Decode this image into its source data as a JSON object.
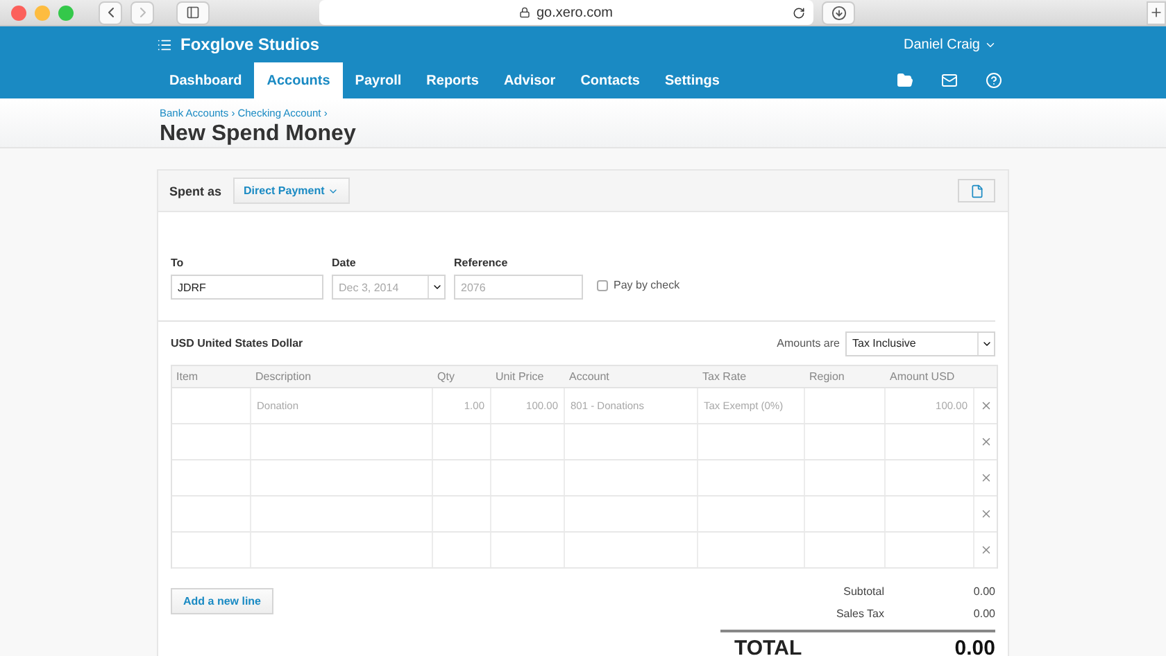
{
  "browser": {
    "url": "go.xero.com"
  },
  "header": {
    "organisation": "Foxglove Studios",
    "user": "Daniel Craig",
    "nav": [
      {
        "label": "Dashboard",
        "selected": false
      },
      {
        "label": "Accounts",
        "selected": true
      },
      {
        "label": "Payroll",
        "selected": false
      },
      {
        "label": "Reports",
        "selected": false
      },
      {
        "label": "Advisor",
        "selected": false
      },
      {
        "label": "Contacts",
        "selected": false
      },
      {
        "label": "Settings",
        "selected": false
      }
    ]
  },
  "breadcrumb": {
    "separator": "›",
    "items": [
      "Bank Accounts",
      "Checking Account"
    ]
  },
  "title": "New Spend Money",
  "spent_as": {
    "label": "Spent as",
    "value": "Direct Payment"
  },
  "form": {
    "to": {
      "label": "To",
      "value": "JDRF"
    },
    "date": {
      "label": "Date",
      "placeholder": "Dec 3, 2014"
    },
    "reference": {
      "label": "Reference",
      "placeholder": "2076"
    },
    "pay_by_check": {
      "label": "Pay by check",
      "checked": false
    }
  },
  "currency": "USD United States Dollar",
  "amounts_are": {
    "label": "Amounts are",
    "value": "Tax Inclusive"
  },
  "table": {
    "columns": [
      "Item",
      "Description",
      "Qty",
      "Unit Price",
      "Account",
      "Tax Rate",
      "Region",
      "Amount USD"
    ],
    "rows": [
      {
        "cells": [
          {},
          {
            "placeholder": "Donation"
          },
          {
            "placeholder": "1.00"
          },
          {
            "placeholder": "100.00"
          },
          {
            "placeholder": "801 - Donations"
          },
          {
            "placeholder": "Tax Exempt (0%)"
          },
          {},
          {
            "placeholder": "100.00"
          }
        ]
      },
      {
        "cells": [
          {},
          {},
          {},
          {},
          {},
          {},
          {},
          {}
        ]
      },
      {
        "cells": [
          {},
          {},
          {},
          {},
          {},
          {},
          {},
          {}
        ]
      },
      {
        "cells": [
          {},
          {},
          {},
          {},
          {},
          {},
          {},
          {}
        ]
      },
      {
        "cells": [
          {},
          {},
          {},
          {},
          {},
          {},
          {},
          {}
        ]
      }
    ]
  },
  "add_line": "Add a new line",
  "totals": {
    "subtotal": {
      "label": "Subtotal",
      "value": "0.00"
    },
    "sales_tax": {
      "label": "Sales Tax",
      "value": "0.00"
    },
    "total": {
      "label": "TOTAL",
      "value": "0.00"
    }
  }
}
